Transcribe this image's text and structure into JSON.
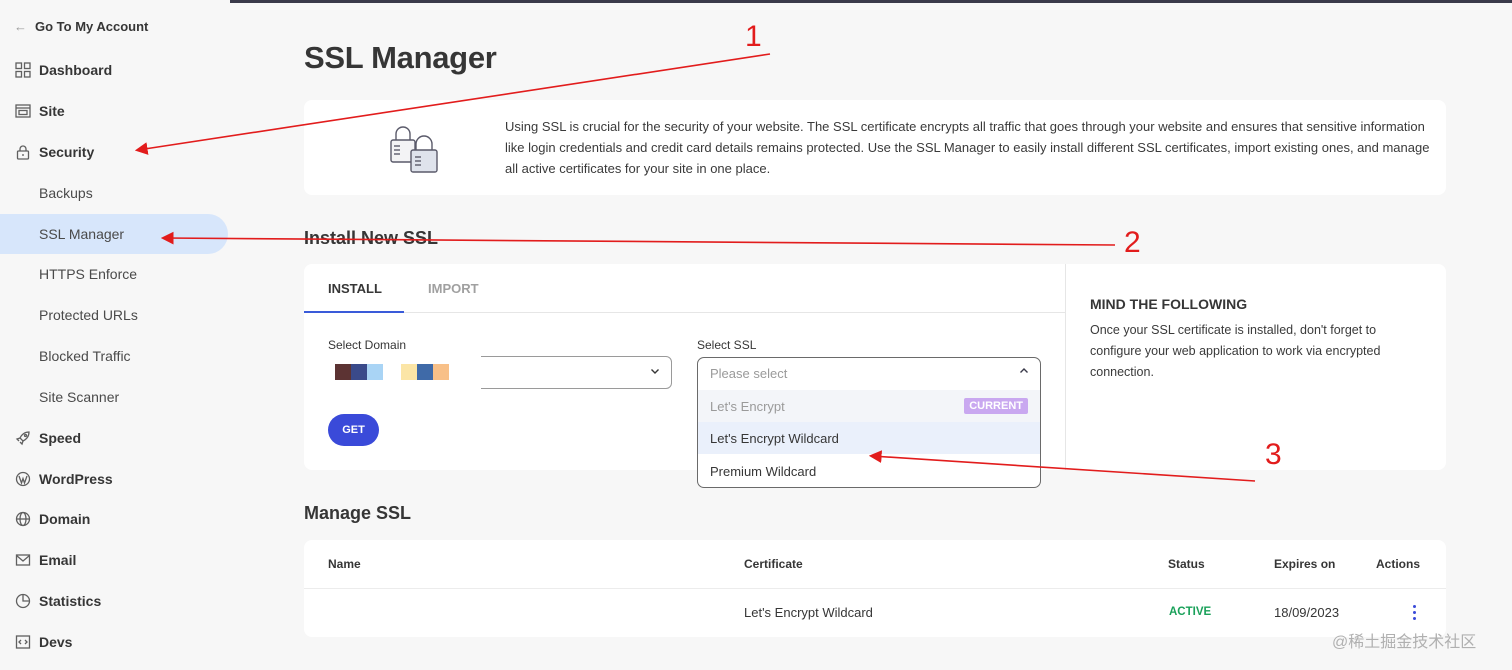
{
  "sidebar": {
    "back_label": "Go To My Account",
    "items": [
      {
        "label": "Dashboard",
        "icon": "grid-icon"
      },
      {
        "label": "Site",
        "icon": "browser-icon"
      },
      {
        "label": "Security",
        "icon": "lock-icon"
      },
      {
        "label": "Speed",
        "icon": "rocket-icon"
      },
      {
        "label": "WordPress",
        "icon": "wordpress-icon"
      },
      {
        "label": "Domain",
        "icon": "globe-icon"
      },
      {
        "label": "Email",
        "icon": "mail-icon"
      },
      {
        "label": "Statistics",
        "icon": "pie-chart-icon"
      },
      {
        "label": "Devs",
        "icon": "code-icon"
      }
    ],
    "security_sub": [
      "Backups",
      "SSL Manager",
      "HTTPS Enforce",
      "Protected URLs",
      "Blocked Traffic",
      "Site Scanner"
    ],
    "active_sub": "SSL Manager"
  },
  "page": {
    "title": "SSL Manager",
    "info_text": "Using SSL is crucial for the security of your website. The SSL certificate encrypts all traffic that goes through your website and ensures that sensitive information like login credentials and credit card details remains protected. Use the SSL Manager to easily install different SSL certificates, import existing ones, and manage all active certificates for your site in one place."
  },
  "install": {
    "section_title": "Install New SSL",
    "tabs": [
      "INSTALL",
      "IMPORT"
    ],
    "active_tab": "INSTALL",
    "domain_label": "Select Domain",
    "ssl_label": "Select SSL",
    "ssl_placeholder": "Please select",
    "ssl_options": [
      {
        "label": "Let's Encrypt",
        "badge": "CURRENT"
      },
      {
        "label": "Let's Encrypt Wildcard"
      },
      {
        "label": "Premium Wildcard"
      }
    ],
    "get_label": "GET",
    "mind_title": "MIND THE FOLLOWING",
    "mind_text": "Once your SSL certificate is installed, don't forget to configure your web application to work via encrypted connection.",
    "domain_swatches": [
      "#5c3333",
      "#3a4a8a",
      "#a9d4f5",
      "#fbe5a6",
      "#3f6aa8",
      "#f8c088"
    ]
  },
  "manage": {
    "section_title": "Manage SSL",
    "headers": [
      "Name",
      "Certificate",
      "Status",
      "Expires on",
      "Actions"
    ],
    "rows": [
      {
        "name": "",
        "certificate": "Let's Encrypt Wildcard",
        "status": "ACTIVE",
        "expires": "18/09/2023"
      }
    ]
  },
  "annotations": [
    "1",
    "2",
    "3"
  ],
  "watermark": "@稀土掘金技术社区",
  "colors": {
    "accent": "#3a4ad9",
    "active_bg": "#d7e6fb",
    "status_active": "#1aa15a",
    "annotation": "#e21c1c",
    "badge": "#c9a8f0"
  }
}
